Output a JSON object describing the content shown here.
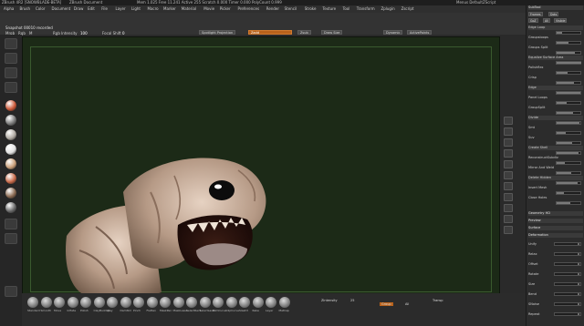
{
  "titlebar": {
    "app": "ZBrush 4R2 [SNOWBLADE-BETA]",
    "doc": "ZBrush Document",
    "mem": "Mem 1.025 Free 11.241 Active 255 Scratch 0.000 Timer 0.000 PolyCount 0.999",
    "right": "Menus  DefaultZScript"
  },
  "menubar": [
    "Alpha",
    "Brush",
    "Color",
    "Document",
    "Draw",
    "Edit",
    "File",
    "Layer",
    "Light",
    "Macro",
    "Marker",
    "Material",
    "Movie",
    "Picker",
    "Preferences",
    "Render",
    "Stencil",
    "Stroke",
    "Texture",
    "Tool",
    "Transform",
    "Zplugin",
    "Zscript"
  ],
  "toolbar": {
    "status": "Snapshot 00010 recorded",
    "mrgb": "Mrgb",
    "rgb": "Rgb",
    "m": "M",
    "rgb_intensity_label": "Rgb Intensity",
    "rgb_intensity_value": "100",
    "focal_label": "Focal Shift",
    "focal_value": "0",
    "lightbox": "LightBox",
    "quick_sketch": "QuickSketch",
    "lightbox_btn": "LightBox",
    "spotlight_btn": "Spotlight",
    "spotlight_projection": "Spotlight Projection",
    "mesh_btn": "MeshLight",
    "zsketch": "ZSketch",
    "z_add": "Zadd",
    "z_sub": "Zsub",
    "draw_size_label": "Draw Size",
    "draw_size_value": "64",
    "dynamic": "Dynamic",
    "zplugin": "Zplugin",
    "activepoints": "ActivePoints",
    "totalpoints": "TotalPoints"
  },
  "rightpanel": {
    "header": "SubTool",
    "title": "Frames",
    "dots": "Dots",
    "goz": "GoZ",
    "all": "All",
    "visible": "Visible",
    "rows": [
      "Edge Loop",
      "Groupsloops",
      "Groups Split",
      "Equalize Surface Area",
      "Polishflex",
      "Crisp",
      "Edge",
      "Panel Loops",
      "GroupSplit",
      "Divide",
      "Smt",
      "Suv",
      "Create Shell",
      "ReconstructSubdiv",
      "Mirror And Weld",
      "Delete Hidden",
      "Insert Mesh",
      "Close Holes"
    ],
    "geometry": "Geometry HD",
    "preview": "Preview",
    "surface": "Surface",
    "deformation": "Deformation",
    "bottom_rows": [
      "Unify",
      "Relax",
      "Offset",
      "Rotate",
      "Size",
      "Bend",
      "SNoise",
      "Repeat"
    ],
    "values": [
      "0",
      "0",
      "0",
      "0",
      "0",
      "0",
      "0",
      "0"
    ]
  },
  "bottomshelf": {
    "brushes": [
      "Standard",
      "Smooth",
      "Move",
      "Inflate",
      "Polish",
      "ClayBuildup",
      "Clay",
      "DamStd",
      "Pinch",
      "Flatten",
      "MaskPen",
      "MaskLasso",
      "SelectRect",
      "SelectLasso",
      "TrimCurve",
      "ClipCurve",
      "Slash3",
      "Rake",
      "Layer",
      "MatCap"
    ],
    "ssrc_label": "Zintensity",
    "ssrc_value": "25",
    "group_btn": "Group",
    "all_btn": "All",
    "transp": "Transp"
  },
  "left_materials": [
    "#cc5a3a",
    "#7a7a7a",
    "#b0aaa2",
    "#e0e0e0",
    "#caa07a",
    "#c86a4a",
    "#8a6a52",
    "#6a6a6a"
  ]
}
